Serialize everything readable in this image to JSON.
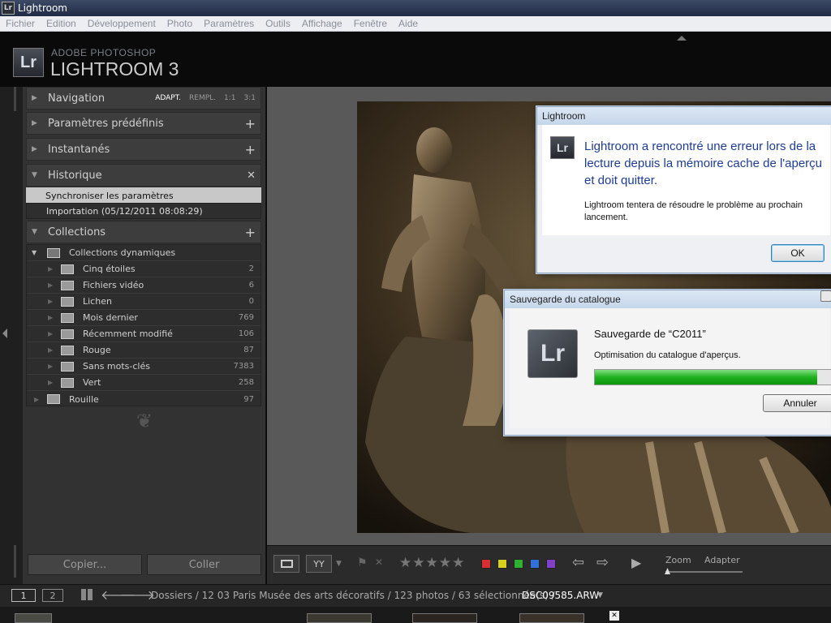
{
  "window": {
    "title": "Lightroom",
    "icon": "Lr"
  },
  "menu": [
    "Fichier",
    "Edition",
    "Développement",
    "Photo",
    "Paramètres",
    "Outils",
    "Affichage",
    "Fenêtre",
    "Aide"
  ],
  "identity": {
    "logo": "Lr",
    "line1": "ADOBE PHOTOSHOP",
    "line2": "LIGHTROOM 3"
  },
  "left_panel": {
    "navigation": {
      "title": "Navigation",
      "options": [
        "ADAPT.",
        "REMPL.",
        "1:1",
        "3:1"
      ],
      "selected": "ADAPT."
    },
    "presets": {
      "title": "Paramètres prédéfinis"
    },
    "snapshots": {
      "title": "Instantanés"
    },
    "history": {
      "title": "Historique",
      "items": [
        "Synchroniser les paramètres",
        "Importation (05/12/2011 08:08:29)"
      ]
    },
    "collections": {
      "title": "Collections",
      "group": "Collections dynamiques",
      "items": [
        {
          "label": "Cinq étoiles",
          "count": "2"
        },
        {
          "label": "Fichiers vidéo",
          "count": "6"
        },
        {
          "label": "Lichen",
          "count": "0"
        },
        {
          "label": "Mois dernier",
          "count": "769"
        },
        {
          "label": "Récemment modifié",
          "count": "106"
        },
        {
          "label": "Rouge",
          "count": "87"
        },
        {
          "label": "Sans mots-clés",
          "count": "7383"
        },
        {
          "label": "Vert",
          "count": "258"
        }
      ],
      "extra": {
        "label": "Rouille",
        "count": "97"
      }
    },
    "copy_button": "Copier...",
    "paste_button": "Coller"
  },
  "toolbar": {
    "zoom_label": "Zoom",
    "zoom_value": "Adapter",
    "stars": "★★★★★",
    "swatches": [
      "#d83030",
      "#d8d020",
      "#30b030",
      "#3070d8",
      "#8040c8"
    ]
  },
  "filmbar": {
    "page1": "1",
    "page2": "2",
    "path": "Dossiers / 12 03 Paris Musée des arts décoratifs / 123 photos / 63 sélectionnée(s) /",
    "file": "DSC09585.ARW"
  },
  "error_dialog": {
    "title": "Lightroom",
    "icon": "Lr",
    "main": "Lightroom a rencontré une erreur lors de la lecture depuis la mémoire cache de l'aperçu et doit quitter.",
    "sub": "Lightroom tentera de résoudre le problème au prochain lancement.",
    "ok": "OK"
  },
  "save_dialog": {
    "title": "Sauvegarde du catalogue",
    "icon": "Lr",
    "heading": "Sauvegarde de “C2011”",
    "status": "Optimisation du catalogue d'aperçus.",
    "progress": 0.92,
    "cancel": "Annuler"
  }
}
